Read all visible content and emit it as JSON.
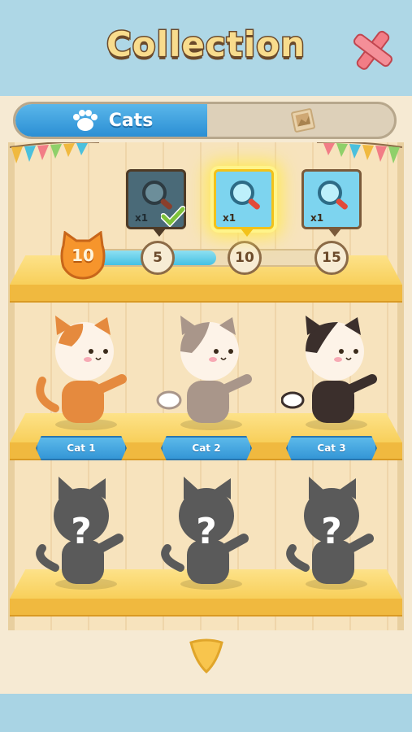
{
  "header": {
    "title": "Collection"
  },
  "tabs": {
    "cats_label": "Cats"
  },
  "progress": {
    "current_level": "10",
    "milestones": [
      "5",
      "10",
      "15"
    ],
    "fill_fraction": 0.5
  },
  "rewards": [
    {
      "count": "x1",
      "state": "claimed"
    },
    {
      "count": "x1",
      "state": "available"
    },
    {
      "count": "x1",
      "state": "locked"
    }
  ],
  "cats": [
    {
      "name": "Cat 1",
      "color": "#e58a3e"
    },
    {
      "name": "Cat 2",
      "color": "#a9968a"
    },
    {
      "name": "Cat 3",
      "color": "#3b2f2c"
    }
  ],
  "locked_marker": "?",
  "colors": {
    "accent": "#2b8fd4",
    "shelf": "#f8cf5a",
    "panel": "#f6ead3",
    "sky": "#a9d4e4"
  }
}
